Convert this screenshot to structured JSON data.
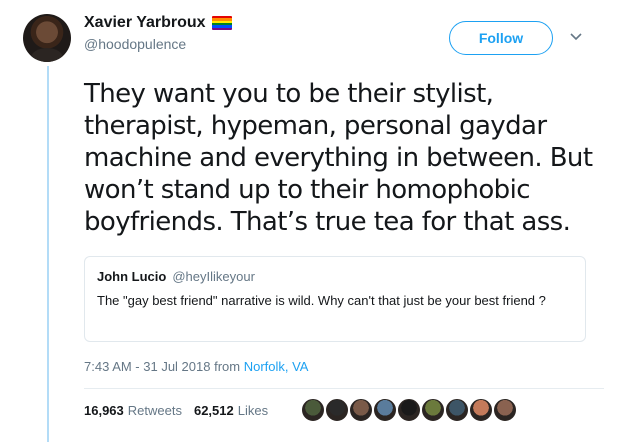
{
  "author": {
    "display_name": "Xavier Yarbroux",
    "handle": "@hoodopulence"
  },
  "follow_label": "Follow",
  "tweet": {
    "text_lines": [
      "They want you to be their stylist,",
      "therapist, hypeman, personal gaydar",
      "machine and everything in between. But",
      "won’t stand up to their homophobic",
      "boyfriends. That’s true tea for that ass."
    ]
  },
  "quote": {
    "display_name": "John Lucio",
    "handle": "@heyIlikeyour",
    "text": "The \"gay best friend\" narrative is wild. Why can't that just be your best friend ?"
  },
  "timestamp": {
    "time_date": "7:43 AM - 31 Jul 2018 from ",
    "location": "Norfolk, VA"
  },
  "stats": {
    "retweets_count": "16,963",
    "retweets_label": "Retweets",
    "likes_count": "62,512",
    "likes_label": "Likes"
  },
  "colors": {
    "accent": "#1da1f2",
    "pride_stripes": [
      "#e40303",
      "#ff8c00",
      "#ffed00",
      "#008026",
      "#004dff",
      "#750787"
    ],
    "liker_avatars": [
      "#4a5a3a",
      "#2a2a2a",
      "#7a5a48",
      "#5a7c9c",
      "#1a1a1a",
      "#6b7a3c",
      "#3d5566",
      "#c47a5a",
      "#8a6250"
    ]
  }
}
